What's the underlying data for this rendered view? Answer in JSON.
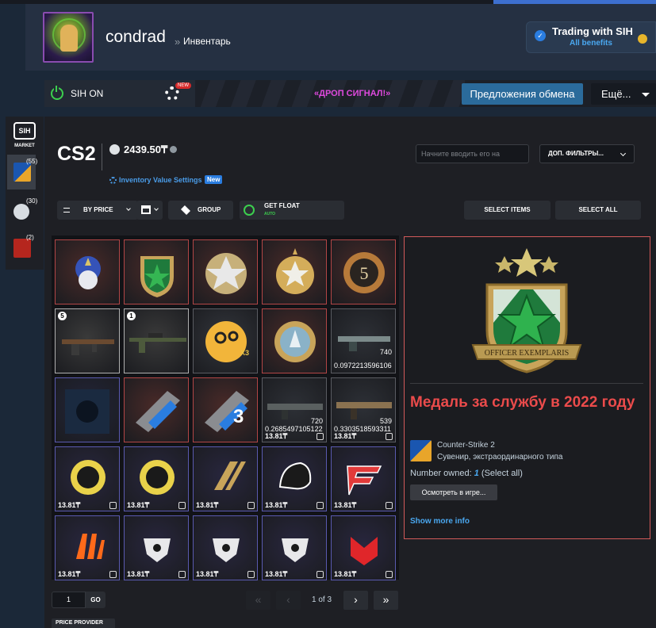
{
  "header": {
    "username": "condrad",
    "breadcrumb_separator": "»",
    "breadcrumb_link": "Инвентарь"
  },
  "trading": {
    "title": "Trading with SIH",
    "subtitle": "All benefits"
  },
  "sih_bar": {
    "status_label": "SIH ON",
    "new_badge": "NEW",
    "banner_text": "«ДРОП СИГНАЛ!»",
    "offers_button": "Предложения обмена",
    "more_button": "Ещё..."
  },
  "sidebar": {
    "logo_text": "SIH",
    "market_label": "MARKET",
    "games": [
      {
        "name": "cs2",
        "count": "(55)",
        "color": "#1a56b0"
      },
      {
        "name": "steam",
        "count": "(30)",
        "color": "#4f6c8c"
      },
      {
        "name": "dota2",
        "count": "(2)",
        "color": "#b5261e"
      }
    ]
  },
  "inventory": {
    "game": "CS2",
    "balance": "2439.50₸",
    "settings_link": "Inventory Value Settings",
    "settings_new": "New",
    "search_placeholder": "Начните вводить его на",
    "filters_button": "ДОП. ФИЛЬТРЫ...",
    "sort_label": "BY PRICE",
    "group_label": "GROUP",
    "float_label": "GET FLOAT",
    "float_auto": "AUTO",
    "select_items": "SELECT ITEMS",
    "select_all": "SELECT ALL"
  },
  "tiles": [
    {
      "kind": "medal-purple",
      "border": "#b34646",
      "bg": "#4a2a28"
    },
    {
      "kind": "medal-green",
      "border": "#b34646",
      "bg": "#4a2a28"
    },
    {
      "kind": "medal-silver",
      "border": "#b34646",
      "bg": "#4a2a28"
    },
    {
      "kind": "medal-gold",
      "border": "#b34646",
      "bg": "#4a2a28"
    },
    {
      "kind": "coin-5",
      "border": "#b34646",
      "bg": "#4a2a28"
    },
    {
      "kind": "ak47",
      "border": "#b0b0b0",
      "bg": "#3a3a3a",
      "count": "5"
    },
    {
      "kind": "awp",
      "border": "#b0b0b0",
      "bg": "#3a3a3a",
      "count": "1"
    },
    {
      "kind": "keychain",
      "border": "#5a5c62",
      "bg": "#33363c",
      "mult": "X3"
    },
    {
      "kind": "coin-holo",
      "border": "#b34646",
      "bg": "#4a2a28"
    },
    {
      "kind": "rifle-camo",
      "border": "#5a5c62",
      "bg": "#2d3036",
      "float": "0.0972213596106",
      "pattern": "740"
    },
    {
      "kind": "music-kit",
      "border": "#5a5ab0",
      "bg": "#23253a"
    },
    {
      "kind": "season-7",
      "border": "#b34646",
      "bg": "#4a2a28"
    },
    {
      "kind": "season-3",
      "border": "#b34646",
      "bg": "#4a2a28"
    },
    {
      "kind": "famas",
      "border": "#5a5c62",
      "bg": "#2d3036",
      "float": "0.2685497105122",
      "pattern": "720",
      "price": "13.81₸"
    },
    {
      "kind": "galil",
      "border": "#5a5c62",
      "bg": "#2d3036",
      "float": "0.3303518593311",
      "pattern": "539",
      "price": "13.81₸"
    },
    {
      "kind": "blast-skull",
      "border": "#5a5ab0",
      "bg": "#28263e",
      "price": "13.81₸"
    },
    {
      "kind": "blast-skull-2",
      "border": "#5a5ab0",
      "bg": "#28263e",
      "price": "13.81₸"
    },
    {
      "kind": "team-gold",
      "border": "#5a5ab0",
      "bg": "#28263e",
      "price": "13.81₸"
    },
    {
      "kind": "furia",
      "border": "#5a5ab0",
      "bg": "#28263e",
      "price": "13.81₸"
    },
    {
      "kind": "faze",
      "border": "#5a5ab0",
      "bg": "#28263e",
      "price": "13.81₸"
    },
    {
      "kind": "fnatic",
      "border": "#5a5ab0",
      "bg": "#28263e",
      "price": "13.81₸"
    },
    {
      "kind": "wolf-1",
      "border": "#5a5ab0",
      "bg": "#28263e",
      "price": "13.81₸"
    },
    {
      "kind": "wolf-2",
      "border": "#5a5ab0",
      "bg": "#28263e",
      "price": "13.81₸"
    },
    {
      "kind": "wolf-3",
      "border": "#5a5ab0",
      "bg": "#28263e",
      "price": "13.81₸"
    },
    {
      "kind": "mouz",
      "border": "#5a5ab0",
      "bg": "#28263e",
      "price": "13.81₸"
    }
  ],
  "pager": {
    "page_input": "1",
    "go_label": "GO",
    "first": "«",
    "prev": "‹",
    "status": "1 of 3",
    "next": "›",
    "last": "»",
    "price_provider": "PRICE PROVIDER"
  },
  "detail": {
    "title": "Медаль за службу в 2022 году",
    "medal_ribbon_text": "OFFICER EXEMPLARIS",
    "game_name": "Counter-Strike 2",
    "item_type": "Сувенир, экстраординарного типа",
    "owned_prefix": "Number owned: ",
    "owned_count": "1",
    "owned_select_all": "(Select all)",
    "inspect_button": "Осмотреть в игре...",
    "show_more": "Show more info"
  }
}
